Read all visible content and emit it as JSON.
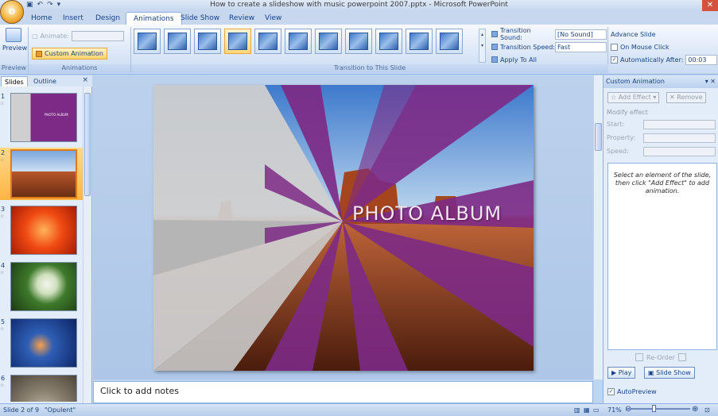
{
  "window": {
    "title": "How to create a slideshow with music powerpoint 2007.pptx - Microsoft PowerPoint",
    "office_button": "O"
  },
  "ribbon_tabs": [
    "Home",
    "Insert",
    "Design",
    "Animations",
    "Slide Show",
    "Review",
    "View"
  ],
  "ribbon": {
    "preview_label": "Preview",
    "preview_group": "Preview",
    "animate_label": "Animate:",
    "custom_animation_label": "Custom Animation",
    "animations_group": "Animations",
    "transition_group": "Transition to This Slide",
    "transition_sound_label": "Transition Sound:",
    "transition_sound_value": "[No Sound]",
    "transition_speed_label": "Transition Speed:",
    "transition_speed_value": "Fast",
    "apply_to_all": "Apply To All",
    "advance_slide_title": "Advance Slide",
    "on_mouse_click": "On Mouse Click",
    "automatically_after": "Automatically After:",
    "automatically_after_value": "00:03"
  },
  "slides_pane": {
    "tab_slides": "Slides",
    "tab_outline": "Outline",
    "close": "×",
    "items": [
      {
        "num": "1"
      },
      {
        "num": "2"
      },
      {
        "num": "3"
      },
      {
        "num": "4"
      },
      {
        "num": "5"
      },
      {
        "num": "6"
      }
    ],
    "thumb1_title": "PHOTO ALBUM"
  },
  "slide": {
    "title": "PHOTO ALBUM"
  },
  "notes": {
    "placeholder": "Click to add notes"
  },
  "custom_animation_pane": {
    "title": "Custom Animation",
    "add_effect": "Add Effect",
    "remove": "Remove",
    "modify_effect": "Modify effect",
    "start_label": "Start:",
    "property_label": "Property:",
    "speed_label": "Speed:",
    "hint": "Select an element of the slide, then click \"Add Effect\" to add animation.",
    "reorder": "Re-Order",
    "play": "Play",
    "slide_show": "Slide Show",
    "autopreview": "AutoPreview"
  },
  "status": {
    "slide_info": "Slide 2 of 9",
    "theme": "\"Opulent\"",
    "zoom": "71%"
  },
  "colors": {
    "ray_purple": "#7d2a86",
    "ray_grey": "#cfcfcf",
    "accent_orange": "#ffb443"
  }
}
